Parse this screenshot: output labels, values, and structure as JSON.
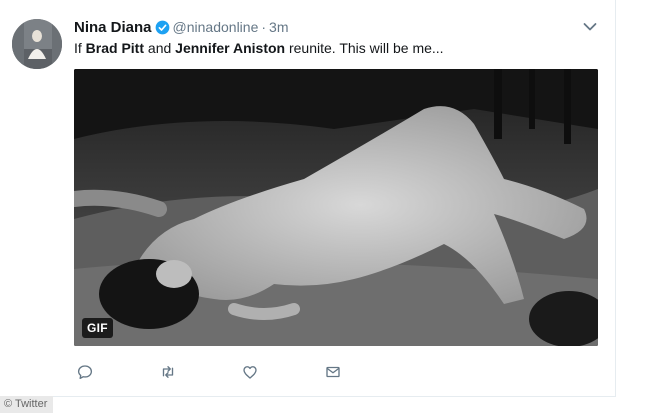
{
  "tweet": {
    "display_name": "Nina Diana",
    "handle": "@ninadonline",
    "separator": "·",
    "time": "3m",
    "text_parts": {
      "p1": "If ",
      "p2": "Brad Pitt",
      "p3": " and ",
      "p4": "Jennifer Aniston",
      "p5": " reunite. This will be me..."
    },
    "media_badge": "GIF"
  },
  "actions": [
    "reply-icon",
    "retweet-icon",
    "like-icon",
    "message-icon"
  ],
  "colors": {
    "verified": "#1da1f2",
    "meta_gray": "#657786",
    "icon_gray": "#657786"
  },
  "credit": "© Twitter"
}
